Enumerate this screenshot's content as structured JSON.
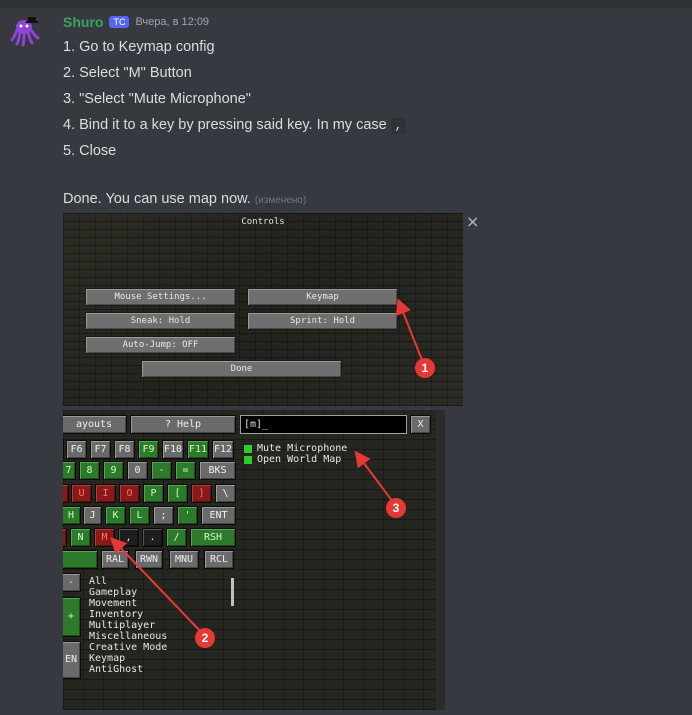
{
  "message": {
    "username": "Shuro",
    "tag": "TC",
    "timestamp": "Вчера, в 12:09",
    "lines": [
      "1. Go to Keymap config",
      "2. Select \"M\" Button",
      "3. \"Select \"Mute Microphone\"",
      "4. Bind it to a key by pressing said key. In my case",
      "5. Close"
    ],
    "inline_code": ",",
    "done_text": "Done. You can use map now.",
    "edited": "(изменено)"
  },
  "screenshot1": {
    "title": "Controls",
    "buttons": {
      "mouse_settings": "Mouse Settings...",
      "keymap": "Keymap",
      "sneak": "Sneak: Hold",
      "sprint": "Sprint: Hold",
      "auto_jump": "Auto-Jump: OFF",
      "done": "Done"
    },
    "close_icon": "×"
  },
  "screenshot2": {
    "layouts_label": "ayouts",
    "help_label": "? Help",
    "search_value": "[m]_",
    "close_label": "X",
    "keys": {
      "f6": "F6",
      "f7": "F7",
      "f8": "F8",
      "f9": "F9",
      "f10": "F10",
      "f11": "F11",
      "f12": "F12",
      "n7": "7",
      "n8": "8",
      "n9": "9",
      "n0": "0",
      "minus": "-",
      "equals": "=",
      "bks": "BKS",
      "u": "U",
      "i": "I",
      "o": "O",
      "p": "P",
      "lbr": "[",
      "rbr": "]",
      "bslash": "\\",
      "h": "H",
      "j": "J",
      "k": "K",
      "l": "L",
      "semi": ";",
      "quote": "'",
      "ent": "ENT",
      "n": "N",
      "m": "M",
      "comma": ",",
      "period": ".",
      "slash": "/",
      "rsh": "RSH",
      "ral": "RAL",
      "rwn": "RWN",
      "mnu": "MNU",
      "rcl": "RCL",
      "side_minus": "-",
      "side_plus": "+",
      "side_en": "EN"
    },
    "results": [
      "Mute Microphone",
      "Open World Map"
    ],
    "categories": [
      "All",
      "Gameplay",
      "Movement",
      "Inventory",
      "Multiplayer",
      "Miscellaneous",
      "Creative Mode",
      "Keymap",
      "AntiGhost"
    ]
  },
  "annotations": [
    "1",
    "2",
    "3"
  ],
  "colors": {
    "background": "#36393f",
    "username": "#3ba55c",
    "tag": "#5865f2",
    "arrow": "#e53935"
  }
}
